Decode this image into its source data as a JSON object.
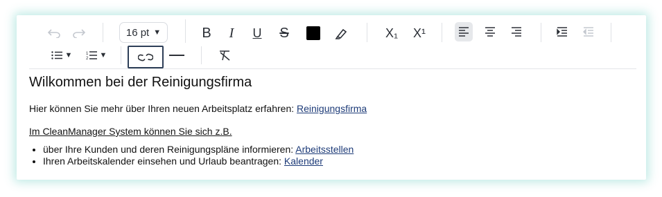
{
  "toolbar": {
    "font_size": "16 pt",
    "bold_glyph": "B",
    "italic_glyph": "I",
    "underline_glyph": "U",
    "strike_glyph": "S",
    "subscript_glyph": "X₁",
    "superscript_glyph": "X¹",
    "text_color": "#000000",
    "undo_icon": "undo-icon",
    "redo_icon": "redo-icon"
  },
  "content": {
    "heading": "Wilkommen bei der Reinigungsfirma",
    "intro_text": "Hier können Sie mehr über Ihren neuen Arbeitsplatz erfahren: ",
    "intro_link": "Reinigungsfirma",
    "system_line": "Im CleanManager System können Sie sich z.B.",
    "list": [
      {
        "text": "über Ihre Kunden und deren Reinigungspläne informieren: ",
        "link": "Arbeitsstellen"
      },
      {
        "text": "Ihren Arbeitskalender einsehen und Urlaub beantragen: ",
        "link": "Kalender"
      }
    ]
  },
  "colors": {
    "accent_link": "#1d3b78",
    "glow": "#78d2c8",
    "active_button_border": "#2d3e57"
  }
}
